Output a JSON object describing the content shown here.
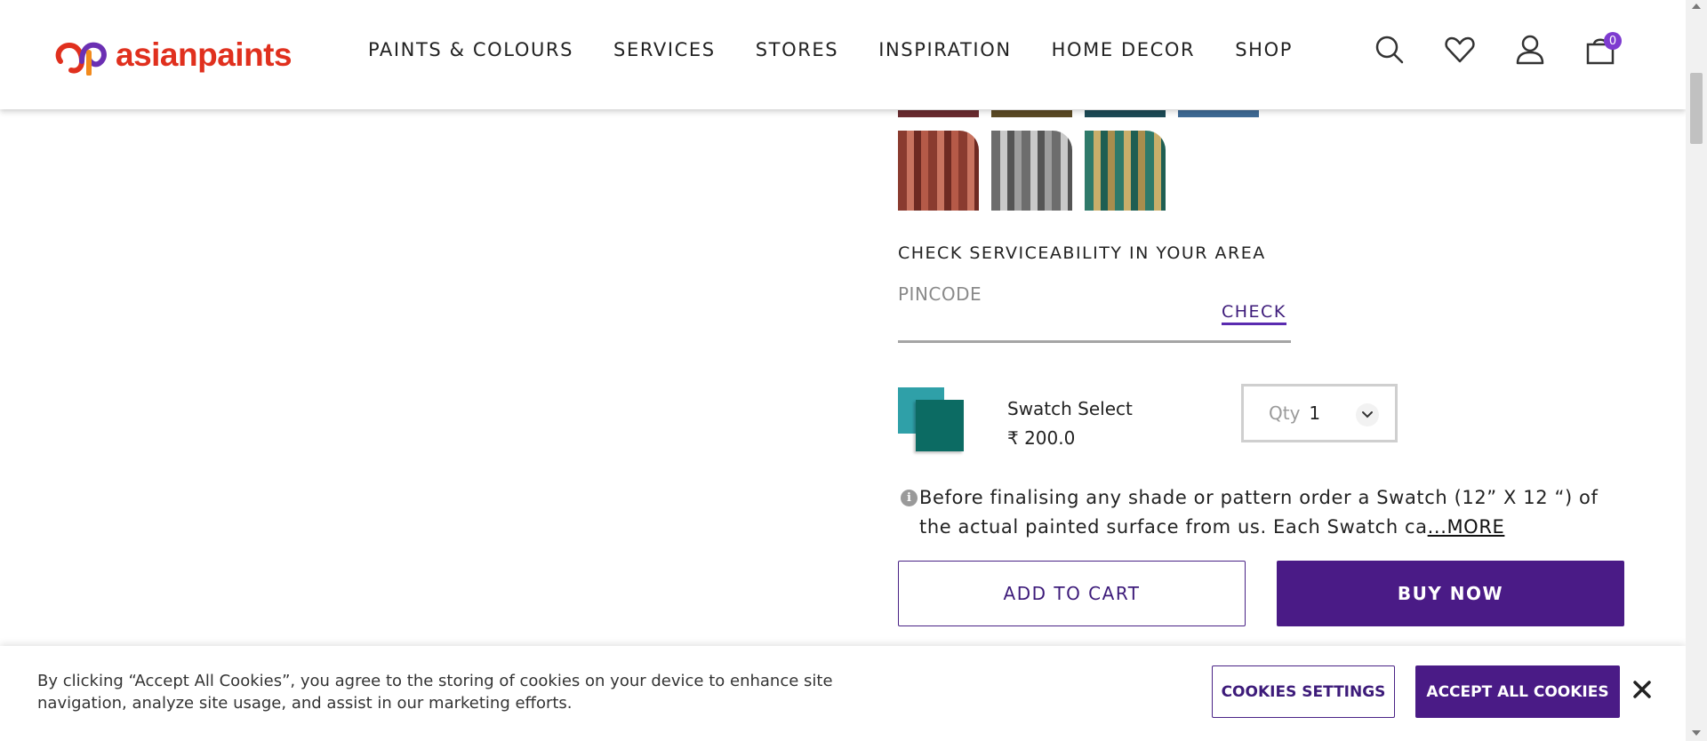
{
  "brand": {
    "name": "asianpaints",
    "color": "#e0301e"
  },
  "nav": {
    "items": [
      "PAINTS & COLOURS",
      "SERVICES",
      "STORES",
      "INSPIRATION",
      "HOME DECOR",
      "SHOP"
    ]
  },
  "header_icons": {
    "search": "search-icon",
    "wishlist": "heart-icon",
    "account": "user-icon",
    "cart": "cart-icon",
    "cart_count": "0"
  },
  "serviceability": {
    "title": "CHECK SERVICEABILITY IN YOUR AREA",
    "pincode_placeholder": "PINCODE",
    "check_label": "CHECK"
  },
  "product": {
    "name": "Swatch Select",
    "price": "₹ 200.0",
    "qty_label": "Qty",
    "qty_value": "1"
  },
  "note": {
    "text": "Before finalising any shade or pattern order a Swatch (12” X 12 “) of the actual painted surface from us. Each Swatch ca",
    "more": "...MORE"
  },
  "actions": {
    "add_to_cart": "ADD TO CART",
    "buy_now": "BUY NOW"
  },
  "cookie": {
    "text": "By clicking “Accept All Cookies”, you agree to the storing of cookies on your device to enhance site navigation, analyze site usage, and assist in our marketing efforts.",
    "settings_label": "COOKIES SETTINGS",
    "accept_label": "ACCEPT ALL COOKIES"
  },
  "colors": {
    "accent": "#4a1b86",
    "badge": "#7e3bd0"
  }
}
